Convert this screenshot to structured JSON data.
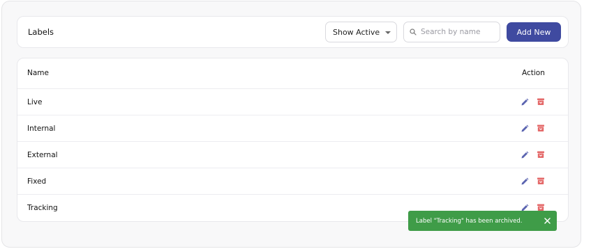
{
  "header": {
    "title": "Labels",
    "filter_selected": "Show Active",
    "search_placeholder": "Search by name",
    "add_label": "Add New"
  },
  "table": {
    "columns": [
      "Name",
      "Action"
    ],
    "rows": [
      {
        "name": "Live"
      },
      {
        "name": "Internal"
      },
      {
        "name": "External"
      },
      {
        "name": "Fixed"
      },
      {
        "name": "Tracking"
      }
    ]
  },
  "toast": {
    "message": "Label \"Tracking\" has been archived."
  },
  "icons": {
    "search": "search-icon",
    "edit": "pencil-icon",
    "delete": "archive-icon",
    "close": "close-icon",
    "dropdown": "chevron-down-icon"
  },
  "colors": {
    "primary": "#3f4aa0",
    "edit": "#5b64b0",
    "delete": "#e46a6a",
    "toast": "#3f9c48"
  }
}
